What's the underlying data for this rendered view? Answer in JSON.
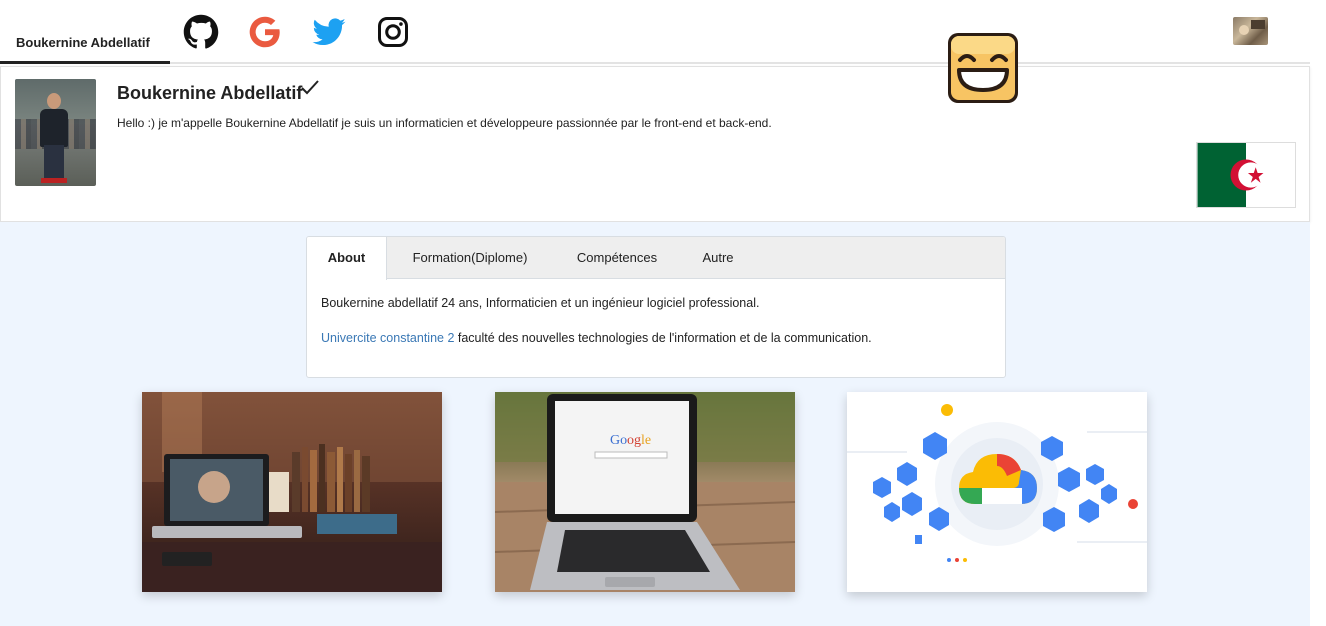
{
  "nav": {
    "brand": "Boukernine Abdellatif",
    "social": [
      "github-icon",
      "google-icon",
      "twitter-icon",
      "instagram-icon"
    ]
  },
  "profile": {
    "name": "Boukernine Abdellatif",
    "bio": "Hello :) je m'appelle Boukernine Abdellatif je suis un informaticien et développeure passionnée par le front-end et back-end.",
    "flag": "algeria-flag"
  },
  "tabs": {
    "items": [
      "About",
      "Formation(Diplome)",
      "Compétences",
      "Autre"
    ],
    "active": "About"
  },
  "about": {
    "line1": "Boukernine abdellatif 24 ans, Informaticien et un ingénieur logiciel professional.",
    "link": "Univercite constantine 2",
    "line2_rest": " faculté des nouvelles technologies de l'information et de la communication."
  },
  "colors": {
    "accent_link": "#3a78b5",
    "page_bg": "#eef5fe",
    "twitter": "#1da1f2",
    "google": "#ea5a40"
  }
}
